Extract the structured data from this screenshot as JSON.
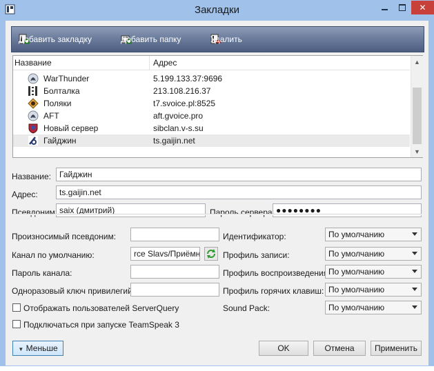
{
  "window": {
    "title": "Закладки",
    "close_glyph": "✕"
  },
  "toolbar": {
    "add_bookmark": "Добавить закладку",
    "add_folder": "Добавить папку",
    "delete": "Удалить"
  },
  "tree": {
    "col_name": "Название",
    "col_address": "Адрес",
    "rows": [
      {
        "name": "WarThunder",
        "address": "5.199.133.37:9696",
        "icon": "teamspeak-icon"
      },
      {
        "name": "Болталка",
        "address": "213.108.216.37",
        "icon": "server-grid-icon"
      },
      {
        "name": "Поляки",
        "address": "t7.svoice.pl:8525",
        "icon": "teamspeak-diamond-icon"
      },
      {
        "name": "AFT",
        "address": "aft.gvoice.pro",
        "icon": "teamspeak-icon"
      },
      {
        "name": "Новый сервер",
        "address": "sibclan.v-s.su",
        "icon": "shield-emblem-icon"
      },
      {
        "name": "Гайджин",
        "address": "ts.gaijin.net",
        "icon": "gaijin-logo-icon",
        "selected": true
      }
    ]
  },
  "form": {
    "name_label": "Название:",
    "name_value": "Гайджин",
    "address_label": "Адрес:",
    "address_value": "ts.gaijin.net",
    "nickname_label": "Псевдоним:",
    "nickname_value": "saix (дмитрий)",
    "server_password_label": "Пароль сервера:",
    "server_password_value": "●●●●●●●●",
    "phonetic_label": "Произносимый псевдоним:",
    "phonetic_value": "",
    "default_channel_label": "Канал по умолчанию:",
    "default_channel_value": "rce Slavs/Приёмная",
    "channel_password_label": "Пароль канала:",
    "channel_password_value": "",
    "privilege_key_label": "Одноразовый ключ привилегий:",
    "privilege_key_value": "",
    "identity_label": "Идентификатор:",
    "identity_value": "По умолчанию",
    "capture_label": "Профиль записи:",
    "capture_value": "По умолчанию",
    "playback_label": "Профиль воспроизведения:",
    "playback_value": "По умолчанию",
    "hotkey_label": "Профиль горячих клавиш:",
    "hotkey_value": "По умолчанию",
    "soundpack_label": "Sound Pack:",
    "soundpack_value": "По умолчанию",
    "show_serverquery_label": "Отображать пользователей ServerQuery",
    "connect_on_startup_label": "Подключаться при запуске TeamSpeak 3"
  },
  "buttons": {
    "less": "Меньше",
    "ok": "OK",
    "cancel": "Отмена",
    "apply": "Применить"
  }
}
